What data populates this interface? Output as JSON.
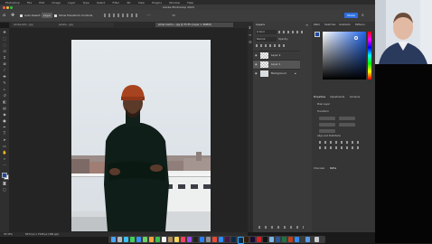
{
  "menubar": {
    "items": [
      "Photoshop",
      "File",
      "Edit",
      "Image",
      "Layer",
      "Type",
      "Select",
      "Filter",
      "3D",
      "View",
      "Plugins",
      "Window",
      "Help"
    ]
  },
  "titlebar": {
    "title": "Adobe Photoshop 2024"
  },
  "options": {
    "auto_select": "Auto-Select:",
    "layer_value": "Layer",
    "transform_label": "Show Transform Controls"
  },
  "share": {
    "label": "Share"
  },
  "tabs": [
    {
      "label": "adobe-edit-...jpg"
    },
    {
      "label": "pexels-...jpg"
    },
    {
      "label": "philip-martin-...jpg @ 33.3% (Layer 1, RGB/8)"
    }
  ],
  "status": {
    "zoom": "33.33%",
    "info": "5072 px x 7528 px (300 ppi)"
  },
  "layers_panel": {
    "title": "Layers",
    "kind_label": "Q Kind",
    "blend_mode": "Normal",
    "opacity": "Opacity:",
    "layers": [
      {
        "name": "Layer 2"
      },
      {
        "name": "Layer 1"
      },
      {
        "name": "Background"
      }
    ]
  },
  "color_panel": {
    "tabs": [
      "Color",
      "Swatches",
      "Gradients",
      "Patterns"
    ]
  },
  "properties_panel": {
    "tabs": [
      "Properties",
      "Adjustments",
      "Libraries"
    ],
    "pixel_layer": "Pixel Layer",
    "transform": "Transform",
    "align": "Align and Distribute"
  },
  "bottom_tabs": [
    "Channels",
    "Paths"
  ],
  "colors": {
    "accent": "#2f6fe0",
    "panel": "#3a3a3a",
    "canvas_bg": "#242424"
  }
}
